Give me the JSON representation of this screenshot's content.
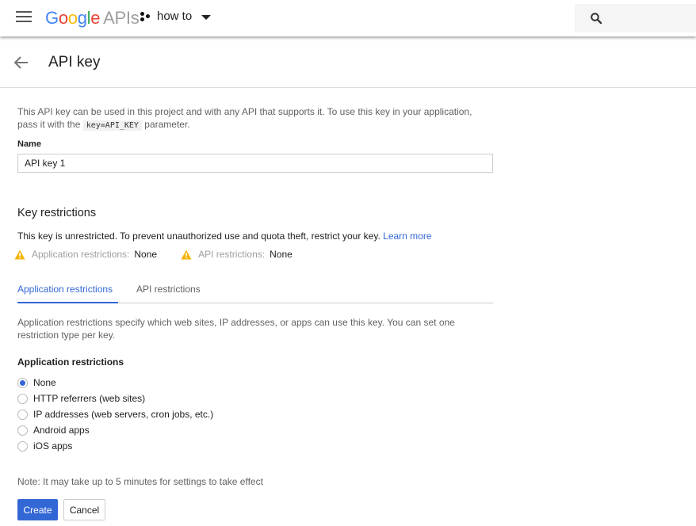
{
  "topbar": {
    "logo_letters": [
      "G",
      "o",
      "o",
      "g",
      "l",
      "e"
    ],
    "logo_suffix": "APIs",
    "project_name": "how to",
    "icons": {
      "menu": "hamburger-menu-icon",
      "project": "project-dots-icon",
      "dropdown": "caret-down-icon",
      "search": "search-icon"
    }
  },
  "header": {
    "title": "API key",
    "back_icon": "arrow-back-icon"
  },
  "form": {
    "description_before": "This API key can be used in this project and with any API that supports it. To use this key in your application, pass it with the ",
    "description_code": "key=API_KEY",
    "description_after": " parameter.",
    "name_label": "Name",
    "name_value": "API key 1"
  },
  "key_restrictions": {
    "title": "Key restrictions",
    "text": "This key is unrestricted. To prevent unauthorized use and quota theft, restrict your key. ",
    "learn_more": "Learn more",
    "status": [
      {
        "label": "Application restrictions:",
        "value": "None",
        "icon": "warning-icon"
      },
      {
        "label": "API restrictions:",
        "value": "None",
        "icon": "warning-icon"
      }
    ]
  },
  "tabs": [
    {
      "label": "Application restrictions",
      "active": true
    },
    {
      "label": "API restrictions",
      "active": false
    }
  ],
  "application_restrictions": {
    "description": "Application restrictions specify which web sites, IP addresses, or apps can use this key. You can set one restriction type per key.",
    "label": "Application restrictions",
    "options": [
      {
        "label": "None",
        "checked": true
      },
      {
        "label": "HTTP referrers (web sites)",
        "checked": false
      },
      {
        "label": "IP addresses (web servers, cron jobs, etc.)",
        "checked": false
      },
      {
        "label": "Android apps",
        "checked": false
      },
      {
        "label": "iOS apps",
        "checked": false
      }
    ]
  },
  "footer": {
    "note": "Note: It may take up to 5 minutes for settings to take effect",
    "create_label": "Create",
    "cancel_label": "Cancel"
  },
  "colors": {
    "accent": "#3367d6",
    "warning": "#f4b400"
  }
}
